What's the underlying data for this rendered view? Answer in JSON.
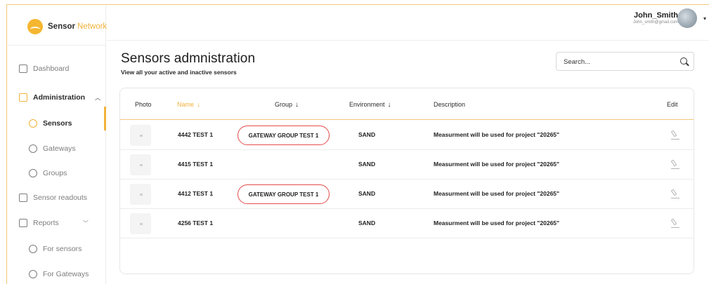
{
  "app": {
    "logo_word1": "Sensor",
    "logo_word2": "Network"
  },
  "colors": {
    "accent": "#f2b23c",
    "highlight_outline": "#e34b4b"
  },
  "sidebar": {
    "items": [
      {
        "label": "Dashboard",
        "icon": "grid-icon"
      },
      {
        "label": "Administration",
        "icon": "tools-icon",
        "expanded": true
      },
      {
        "label": "Sensors",
        "icon": "sensor-icon",
        "active": true
      },
      {
        "label": "Gateways",
        "icon": "gateway-icon"
      },
      {
        "label": "Groups",
        "icon": "groups-icon"
      },
      {
        "label": "Sensor readouts",
        "icon": "chart-icon"
      },
      {
        "label": "Reports",
        "icon": "report-icon"
      },
      {
        "label": "For sensors",
        "icon": "sensor-icon"
      },
      {
        "label": "For Gateways",
        "icon": "gateway-icon"
      }
    ]
  },
  "header": {
    "user_name": "John_Smith",
    "user_email": "John_smith@gmail.com"
  },
  "page": {
    "title": "Sensors admnistration",
    "subtitle": "View all your active and inactive sensors"
  },
  "search": {
    "placeholder": "Search..."
  },
  "table": {
    "columns": [
      "Photo",
      "Name",
      "Group",
      "Environment",
      "Description",
      "Edit"
    ],
    "rows": [
      {
        "name": "4442 TEST 1",
        "group": "GATEWAY GROUP TEST 1",
        "environment": "SAND",
        "description": "Measurment will be used for project \"20265\""
      },
      {
        "name": "4415 TEST 1",
        "group": "",
        "environment": "SAND",
        "description": "Measurment will be used for project \"20265\""
      },
      {
        "name": "4412 TEST 1",
        "group": "GATEWAY GROUP TEST 1",
        "environment": "SAND",
        "description": "Measurment will be used for project \"20265\""
      },
      {
        "name": "4256 TEST 1",
        "group": "",
        "environment": "SAND",
        "description": "Measurment will be used for project \"20265\""
      }
    ]
  }
}
